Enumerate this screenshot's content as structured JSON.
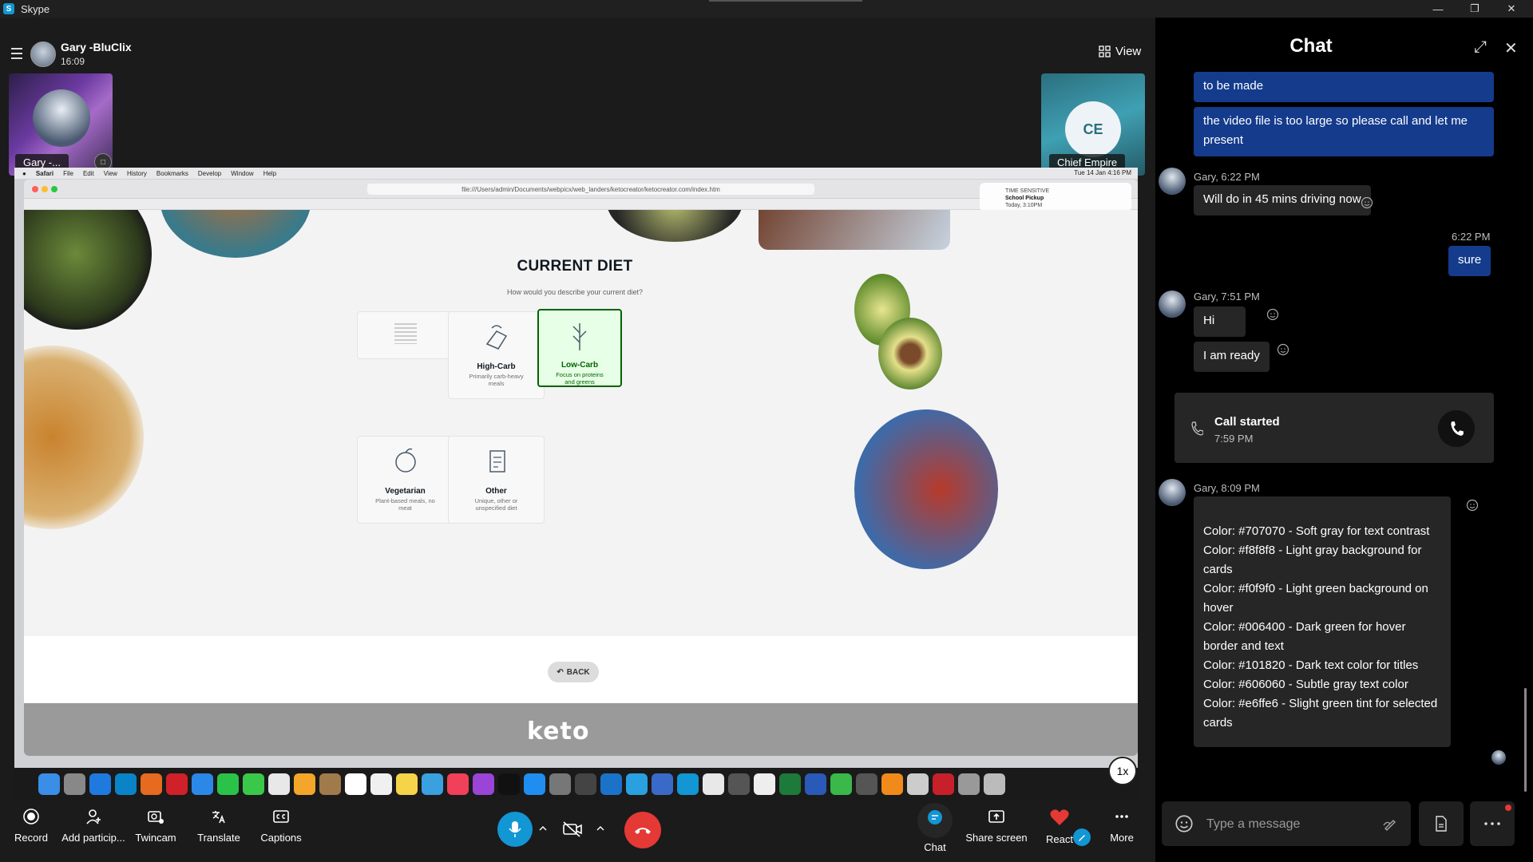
{
  "window": {
    "app_title": "Skype"
  },
  "call": {
    "caller_name": "Gary -BluClix",
    "duration": "16:09",
    "view_label": "View",
    "self_tile_label": "Gary -...",
    "remote_initials": "CE",
    "remote_name": "Chief Empire"
  },
  "shared_screen": {
    "mac_menu": [
      "Safari",
      "File",
      "Edit",
      "View",
      "History",
      "Bookmarks",
      "Develop",
      "Window",
      "Help"
    ],
    "mac_date": "Tue 14 Jan 4:16 PM",
    "url": "file:///Users/admin/Documents/webpicx/web_landers/ketocreator/ketocreator.com/index.htm",
    "notification": {
      "line1": "TIME SENSITIVE",
      "line2": "School Pickup",
      "line3": "Today, 3:10PM"
    },
    "page": {
      "title": "CURRENT DIET",
      "subtitle": "How would you describe your current diet?",
      "cards": [
        {
          "title": "",
          "desc": ""
        },
        {
          "title": "High-Carb",
          "desc": "Primarily carb-heavy meals"
        },
        {
          "title": "Low-Carb",
          "desc": "Focus on proteins and greens"
        },
        {
          "title": "Vegetarian",
          "desc": "Plant-based meals, no meat"
        },
        {
          "title": "Other",
          "desc": "Unique, other or unspecified diet"
        }
      ],
      "back_label": "BACK",
      "logo": "keto"
    },
    "playback_speed": "1x"
  },
  "controls": {
    "record": "Record",
    "add_participant": "Add particip...",
    "twincam": "Twincam",
    "translate": "Translate",
    "captions": "Captions",
    "chat": "Chat",
    "share_screen": "Share screen",
    "react": "React",
    "more": "More"
  },
  "chat": {
    "title": "Chat",
    "messages": {
      "out_1": "to be made",
      "out_2": "the video file is too large so please call and let me present",
      "gary_meta_1": "Gary, 6:22 PM",
      "in_1": "Will do in 45 mins driving now",
      "out_meta_3": "6:22 PM",
      "out_3": "sure",
      "gary_meta_2": "Gary, 7:51 PM",
      "in_2": "Hi",
      "in_3": "I am ready",
      "call_started": "Call started",
      "call_time": "7:59 PM",
      "gary_meta_3": "Gary, 8:09 PM",
      "colors": [
        "Color: #707070 - Soft gray for text contrast",
        "Color: #f8f8f8 - Light gray background for cards",
        "Color: #f0f9f0 - Light green background on hover",
        "Color: #006400 - Dark green for hover border and text",
        "Color: #101820 - Dark text color for titles",
        "Color: #606060 - Subtle gray text color",
        "Color: #e6ffe6 - Slight green tint for selected cards"
      ]
    },
    "composer_placeholder": "Type a message"
  },
  "colors": {
    "accent_blue": "#1296d4",
    "outgoing_bubble": "#143b8c",
    "end_call_red": "#e53935",
    "mic_blue": "#1296d4",
    "selected_green": "#006400"
  }
}
